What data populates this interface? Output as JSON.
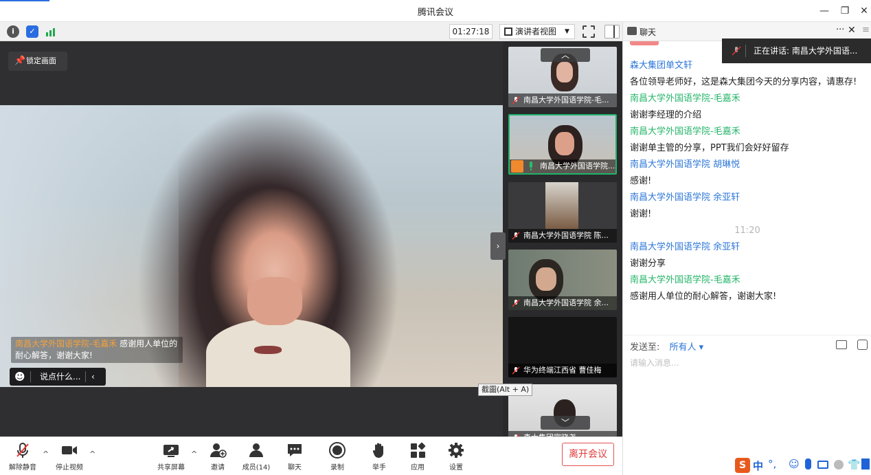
{
  "window": {
    "title": "腾讯会议"
  },
  "toolbar": {
    "timer": "01:27:18",
    "view_label": "演讲者视图"
  },
  "stage": {
    "lock_label": "锁定画面",
    "subtitle_speaker": "南昌大学外国语学院-毛嘉禾",
    "subtitle_text": "感谢用人单位的耐心解答，谢谢大家!",
    "say_placeholder": "说点什么..."
  },
  "thumbnails": [
    {
      "name": "南昌大学外国语学院-毛..."
    },
    {
      "name": "南昌大学外国语学院..."
    },
    {
      "name": "南昌大学外国语学院 陈..."
    },
    {
      "name": "南昌大学外国语学院 余..."
    },
    {
      "name": "华为终端江西省 曹佳梅"
    },
    {
      "name": "森大集团宣晓尧"
    }
  ],
  "screenshot_tooltip": "截圖(Alt + A)",
  "chat": {
    "title": "聊天",
    "speaking": "正在讲话: 南昌大学外国语...",
    "messages": [
      {
        "name": "森大集团单文轩",
        "text": "各位领导老师好，这是森大集团今天的分享内容，请惠存!"
      },
      {
        "name": "南昌大学外国语学院-毛嘉禾",
        "text": "谢谢李经理的介绍"
      },
      {
        "name": "南昌大学外国语学院-毛嘉禾",
        "text": "谢谢单主管的分享，PPT我们会好好留存"
      },
      {
        "name": "南昌大学外国语学院 胡琳悦",
        "text": "感谢!"
      },
      {
        "name": "南昌大学外国语学院 余亚轩",
        "text": "谢谢!"
      }
    ],
    "time_separator": "11:20",
    "messages_after": [
      {
        "name": "南昌大学外国语学院 余亚轩",
        "text": "谢谢分享"
      },
      {
        "name": "南昌大学外国语学院-毛嘉禾",
        "text": "感谢用人单位的耐心解答，谢谢大家!"
      }
    ],
    "send_to_label": "发送至:",
    "send_to_value": "所有人",
    "input_placeholder": "请输入消息..."
  },
  "bottombar": {
    "unmute": "解除静音",
    "stop_video": "停止视频",
    "share_screen": "共享屏幕",
    "invite": "邀请",
    "members": "成员(14)",
    "chat": "聊天",
    "record": "录制",
    "raise_hand": "举手",
    "apps": "应用",
    "settings": "设置",
    "leave": "离开会议"
  },
  "ime": {
    "lang": "中"
  }
}
